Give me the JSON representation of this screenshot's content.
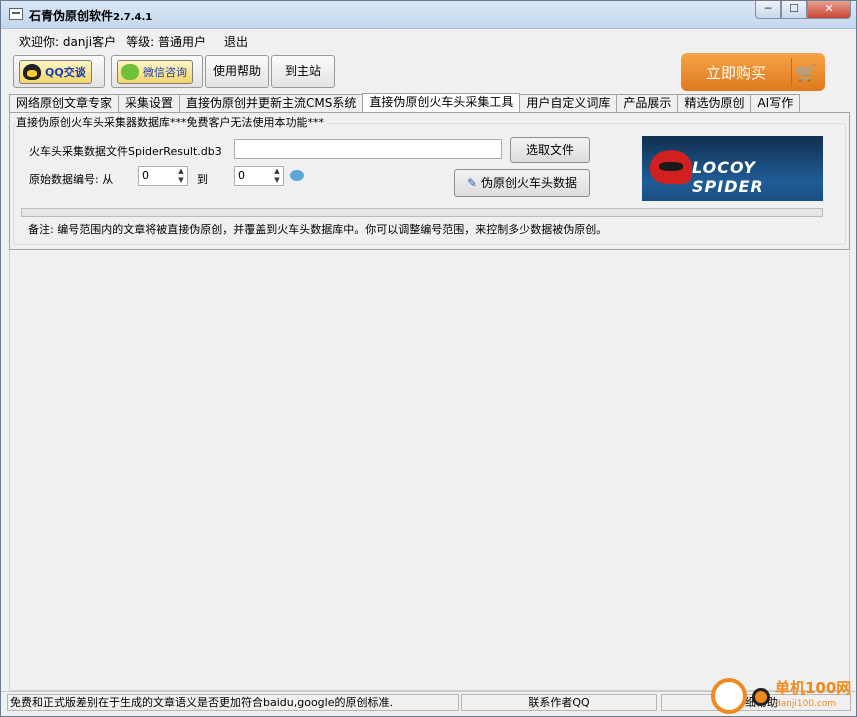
{
  "window": {
    "title": "石青伪原创软件",
    "version": "2.7.4.1",
    "controls": {
      "min": "─",
      "max": "☐",
      "close": "✕"
    }
  },
  "user": {
    "welcome": "欢迎你: danji客户",
    "level": "等级: 普通用户",
    "logout": "退出"
  },
  "toolbar": {
    "qq_label": "QQ交谈",
    "wechat_label": "微信咨询",
    "help_label": "使用帮助",
    "site_label": "到主站",
    "buy_label": "立即购买",
    "cart_icon": "cart-icon"
  },
  "tabs": [
    {
      "label": "网络原创文章专家",
      "active": false
    },
    {
      "label": "采集设置",
      "active": false
    },
    {
      "label": "直接伪原创并更新主流CMS系统",
      "active": false
    },
    {
      "label": "直接伪原创火车头采集工具",
      "active": true
    },
    {
      "label": "用户自定义词库",
      "active": false
    },
    {
      "label": "产品展示",
      "active": false
    },
    {
      "label": "精选伪原创",
      "active": false
    },
    {
      "label": "AI写作",
      "active": false
    }
  ],
  "panel": {
    "group_title": "直接伪原创火车头采集器数据库***免费客户无法使用本功能***",
    "file_label": "火车头采集数据文件SpiderResult.db3",
    "file_value": "",
    "select_file_btn": "选取文件",
    "range_label": "原始数据编号: 从",
    "range_from": "0",
    "range_to_label": "到",
    "range_to": "0",
    "process_btn": "伪原创火车头数据",
    "logo_text": "LOCOY SPIDER",
    "progress": 0,
    "note": "备注: 编号范围内的文章将被直接伪原创，并覆盖到火车头数据库中。你可以调整编号范围，来控制多少数据被伪原创。"
  },
  "status": {
    "message": "免费和正式版差别在于生成的文章语义是否更加符合baidu,google的原创标准.",
    "contact": "联系作者QQ",
    "detail": "详细帮助"
  },
  "watermark": {
    "text": "单机100网",
    "sub": "danji100.com"
  }
}
